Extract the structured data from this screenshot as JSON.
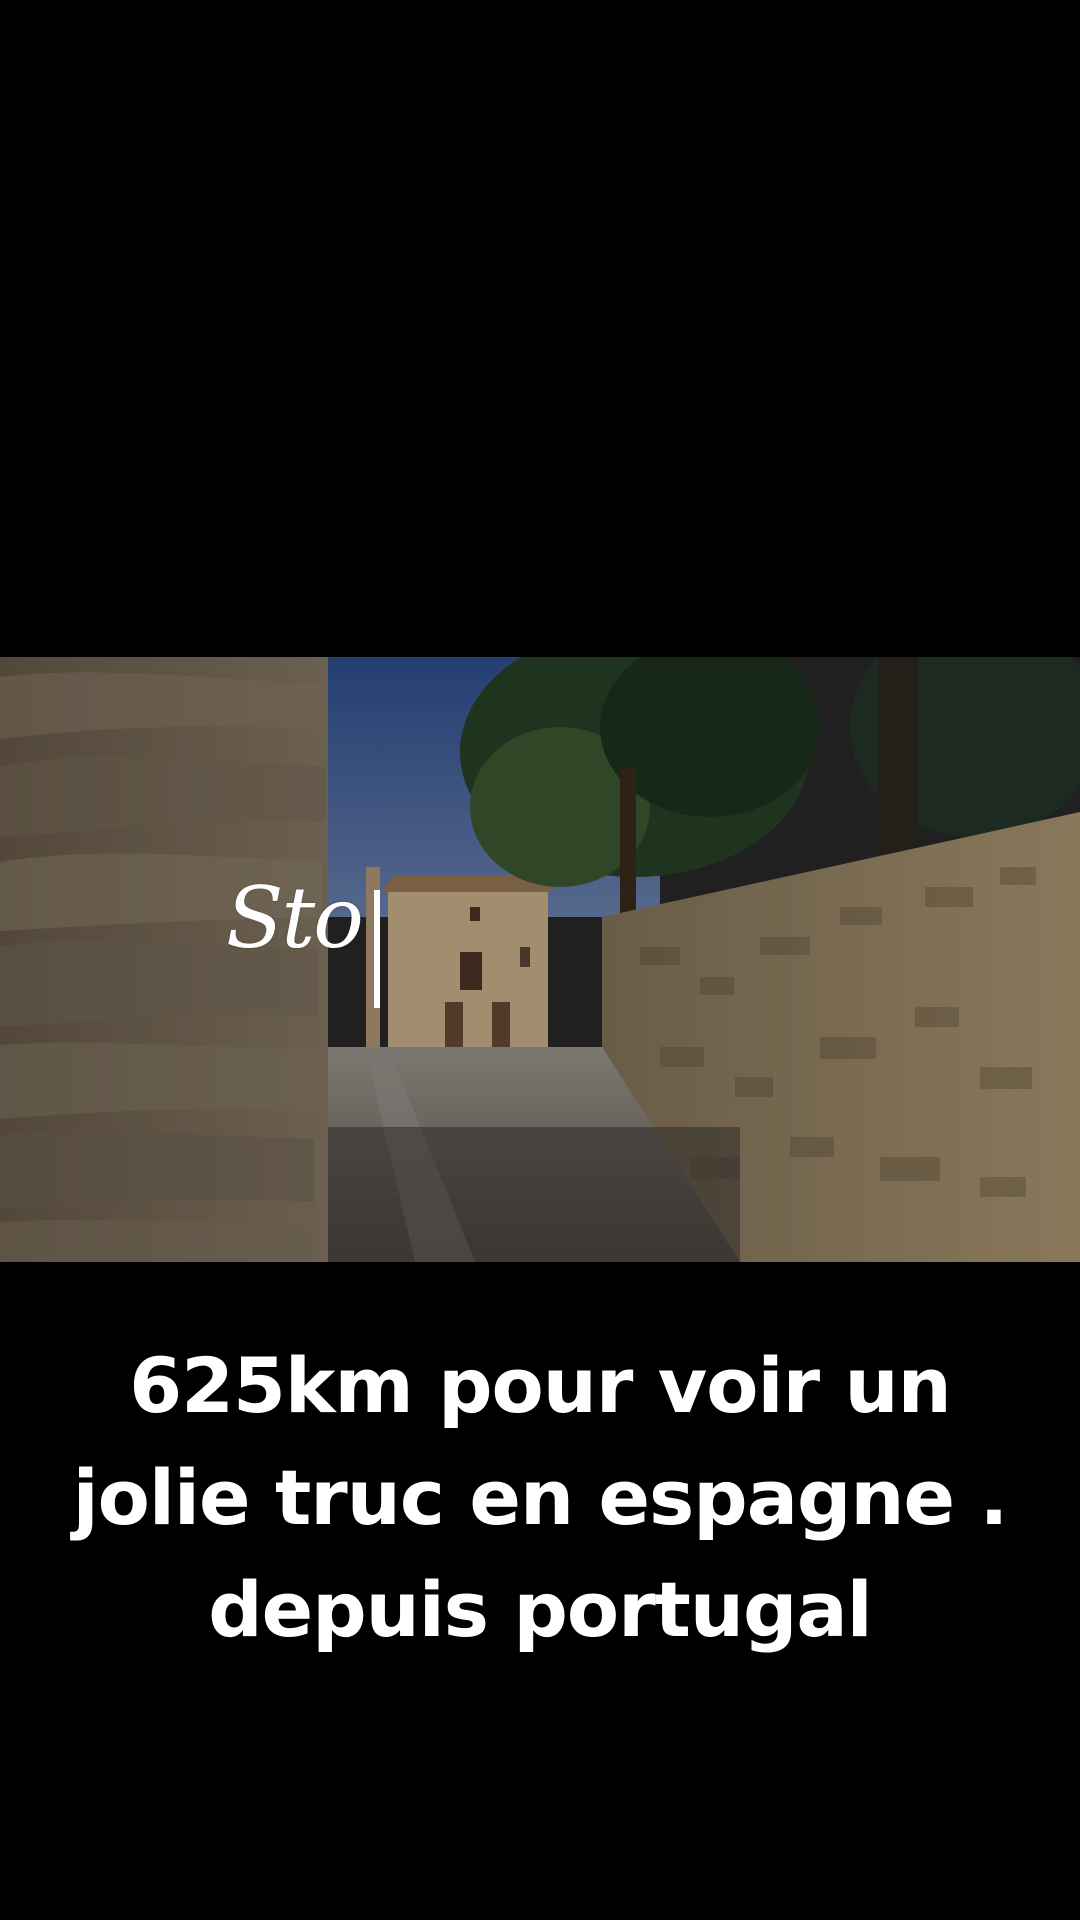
{
  "video": {
    "overlay_text": "Sto",
    "caption": "625km pour voir un jolie truc en espagne . depuis portugal"
  },
  "colors": {
    "background": "#000000",
    "text": "#ffffff"
  }
}
